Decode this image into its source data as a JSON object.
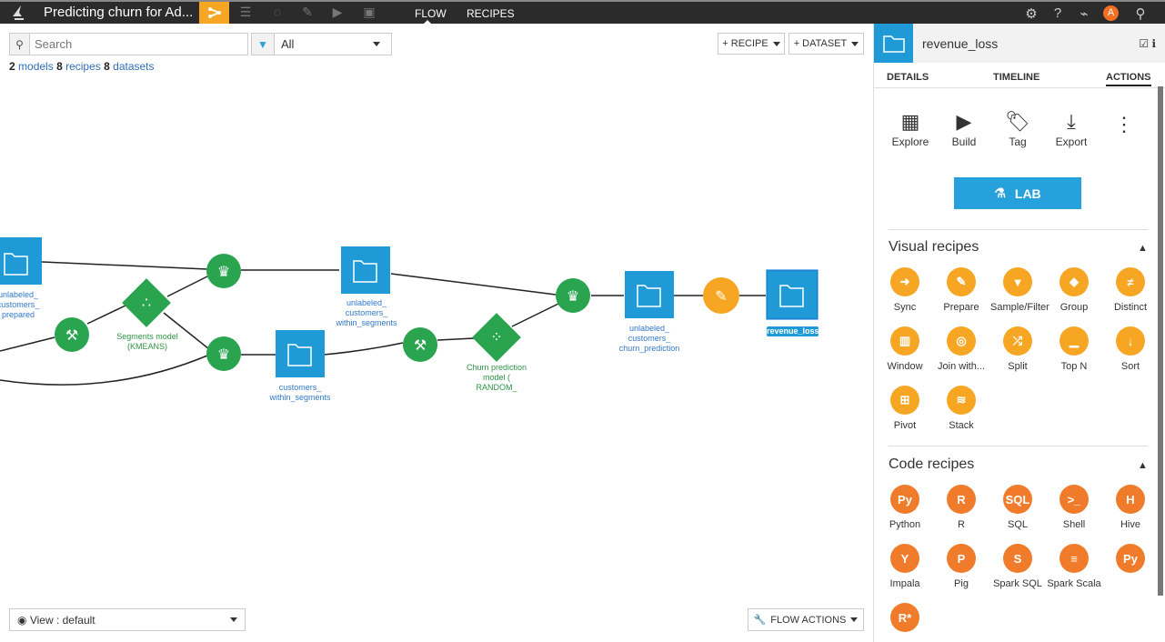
{
  "topbar": {
    "project_title": "Predicting churn for Ad...",
    "icons": [
      "flow-icon",
      "datasets-icon",
      "lab-icon",
      "notebooks-icon",
      "jobs-icon",
      "dashboards-icon"
    ],
    "tabs": [
      {
        "label": "FLOW",
        "active": true
      },
      {
        "label": "RECIPES",
        "active": false
      }
    ],
    "right_icons": [
      "gear-icon",
      "help-icon",
      "activity-icon",
      "avatar",
      "search-icon"
    ],
    "avatar_letter": "A"
  },
  "flow": {
    "search_placeholder": "Search",
    "filter_value": "All",
    "counts": {
      "models": "2",
      "models_label": "models",
      "recipes": "8",
      "recipes_label": "recipes",
      "datasets": "8",
      "datasets_label": "datasets"
    },
    "recipe_button": "+ RECIPE",
    "dataset_button": "+ DATASET",
    "view_select": "View : default",
    "flow_actions": "FLOW ACTIONS",
    "nodes": {
      "ds1": [
        "unlabeled_",
        "customers_",
        "prepared"
      ],
      "model1": [
        "Segments model",
        "(KMEANS)"
      ],
      "ds2": [
        "unlabeled_",
        "customers_",
        "within_segments"
      ],
      "ds3": [
        "customers_",
        "within_segments"
      ],
      "model2": [
        "Churn prediction",
        "model (",
        "RANDOM_"
      ],
      "ds4": [
        "unlabeled_",
        "customers_",
        "churn_prediction"
      ],
      "ds5": "revenue_loss"
    },
    "colors": {
      "dataset": "#1f9ad6",
      "ml": "#2aa44f",
      "visual": "#f6a623",
      "code": "#f07b2b"
    }
  },
  "panel": {
    "title": "revenue_loss",
    "tabs": [
      "DETAILS",
      "TIMELINE",
      "ACTIONS"
    ],
    "active_tab": "ACTIONS",
    "actions": [
      "Explore",
      "Build",
      "Tag",
      "Export"
    ],
    "lab_button": "LAB",
    "visual_title": "Visual recipes",
    "visual": [
      {
        "label": "Sync",
        "glyph": "➜"
      },
      {
        "label": "Prepare",
        "glyph": "✎"
      },
      {
        "label": "Sample/Filter",
        "glyph": "▼"
      },
      {
        "label": "Group",
        "glyph": "◆"
      },
      {
        "label": "Distinct",
        "glyph": "≠"
      },
      {
        "label": "Window",
        "glyph": "▥"
      },
      {
        "label": "Join with...",
        "glyph": "◎"
      },
      {
        "label": "Split",
        "glyph": "⤮"
      },
      {
        "label": "Top N",
        "glyph": "▁"
      },
      {
        "label": "Sort",
        "glyph": "↓"
      },
      {
        "label": "Pivot",
        "glyph": "⊞"
      },
      {
        "label": "Stack",
        "glyph": "≋"
      }
    ],
    "code_title": "Code recipes",
    "code": [
      {
        "label": "Python",
        "glyph": "Py"
      },
      {
        "label": "R",
        "glyph": "R"
      },
      {
        "label": "SQL",
        "glyph": "SQL"
      },
      {
        "label": "Shell",
        "glyph": ">_"
      },
      {
        "label": "Hive",
        "glyph": "H"
      },
      {
        "label": "Impala",
        "glyph": "Y"
      },
      {
        "label": "Pig",
        "glyph": "P"
      },
      {
        "label": "Spark SQL",
        "glyph": "S"
      },
      {
        "label": "Spark Scala",
        "glyph": "≡"
      },
      {
        "label": "",
        "glyph": "Py"
      },
      {
        "label": "",
        "glyph": "R*"
      }
    ]
  }
}
